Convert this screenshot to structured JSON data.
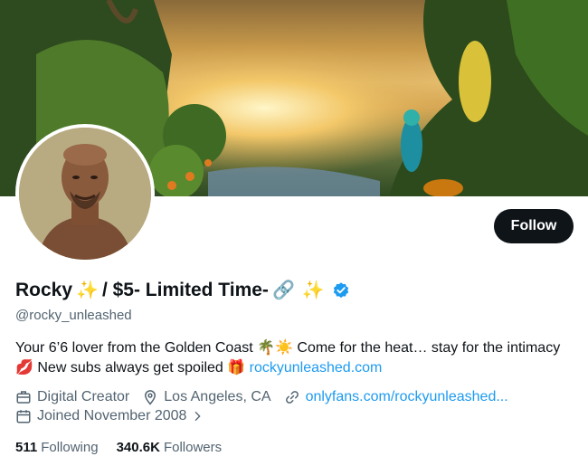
{
  "profile": {
    "display_name": "Rocky",
    "name_suffix": "/ $5- Limited Time-",
    "emoji_sparkles": "✨",
    "emoji_link": "🔗",
    "handle": "@rocky_unleashed",
    "follow_label": "Follow",
    "bio_part1": "Your 6’6 lover from the Golden Coast 🌴☀️ Come for the heat… stay for the intimacy 💋 New subs always get spoiled 🎁 ",
    "bio_link": "rockyunleashed.com",
    "category": "Digital Creator",
    "location": "Los Angeles, CA",
    "website": "onlyfans.com/rockyunleashed...",
    "joined": "Joined November 2008",
    "following_count": "511",
    "following_label": "Following",
    "followers_count": "340.6K",
    "followers_label": "Followers"
  },
  "icons": {
    "verified": "verified-badge-icon",
    "category": "briefcase-icon",
    "location": "location-pin-icon",
    "website": "link-icon",
    "joined": "calendar-icon",
    "chevron": "chevron-right-icon"
  },
  "colors": {
    "accent": "#1d9bf0",
    "text": "#0f1419",
    "muted": "#536471",
    "button_bg": "#0f1419"
  }
}
